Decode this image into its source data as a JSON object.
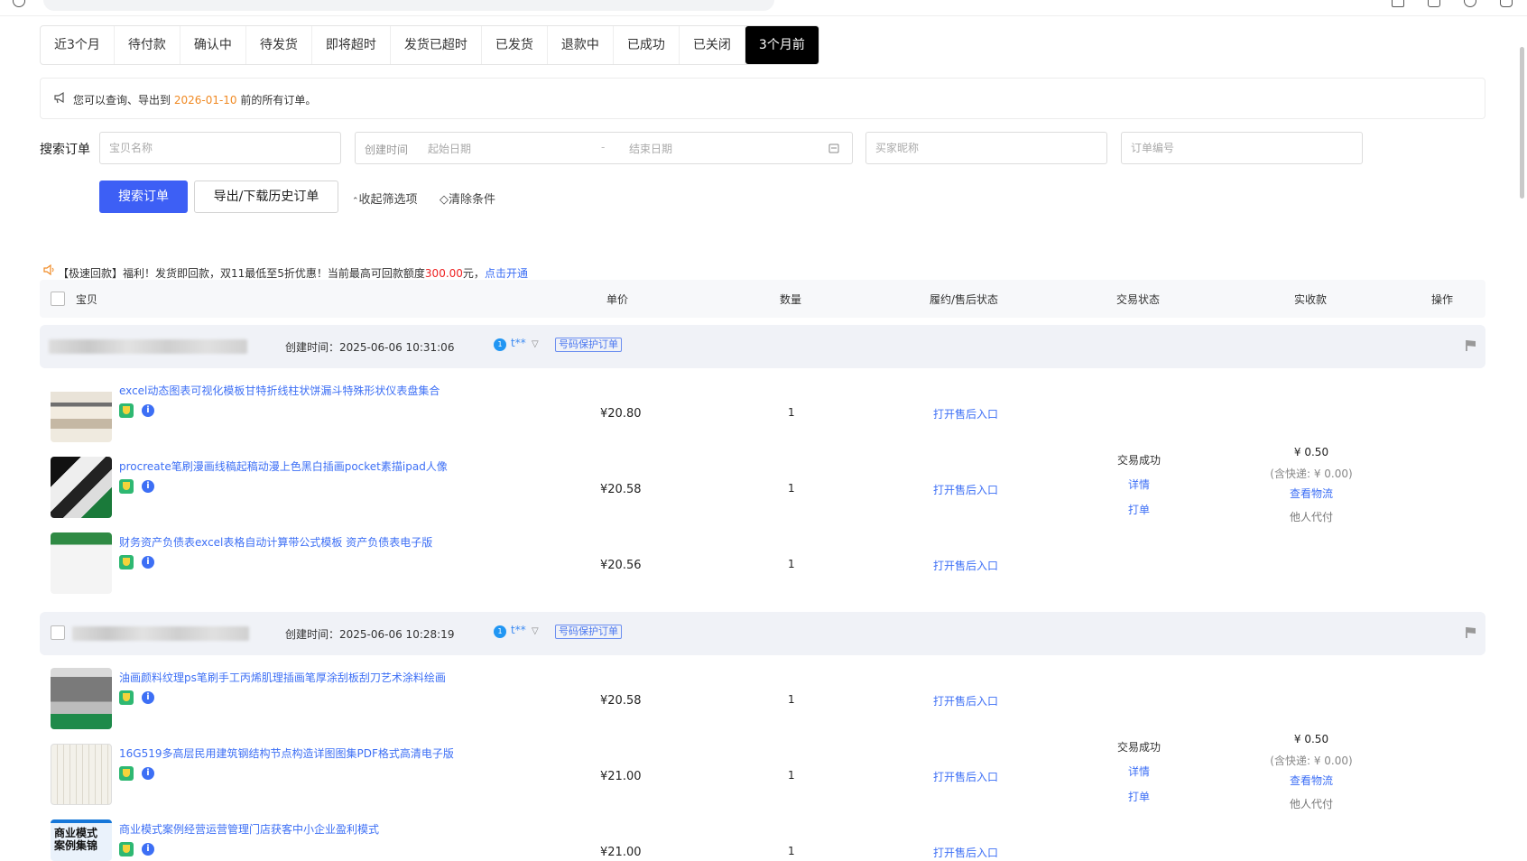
{
  "tabs": [
    "近3个月",
    "待付款",
    "确认中",
    "待发货",
    "即将超时",
    "发货已超时",
    "已发货",
    "退款中",
    "已成功",
    "已关闭",
    "3个月前"
  ],
  "active_tab": "3个月前",
  "notice": {
    "prefix": "您可以查询、导出到 ",
    "date": "2026-01-10",
    "suffix": " 前的所有订单。"
  },
  "search": {
    "label": "搜索订单",
    "item_name_placeholder": "宝贝名称",
    "created_time_label": "创建时间",
    "start_placeholder": "起始日期",
    "end_placeholder": "结束日期",
    "date_sep": "-",
    "buyer_placeholder": "买家昵称",
    "order_no_placeholder": "订单编号",
    "search_button": "搜索订单",
    "export_button": "导出/下载历史订单",
    "collapse_link": "收起筛选项",
    "clear_link": "清除条件"
  },
  "promo": {
    "prefix": "【极速回款】福利！发货即回款，双11最低至5折优惠！当前最高可回款额度",
    "amount": "300.00",
    "unit": "元，",
    "link": "点击开通"
  },
  "table_headers": {
    "item": "宝贝",
    "unit_price": "单价",
    "quantity": "数量",
    "after_sale": "履约/售后状态",
    "trade_status": "交易状态",
    "received": "实收款",
    "action": "操作"
  },
  "orders": [
    {
      "created": "创建时间：2025-06-06 10:31:06",
      "buyer": "t**",
      "protect_tag": "号码保护订单",
      "trade_status": "交易成功",
      "detail_link": "详情",
      "print_link": "打单",
      "received": "¥ 0.50",
      "shipping_note": "(含快递: ¥ 0.00)",
      "logistics_link": "查看物流",
      "paid_by": "他人代付",
      "items": [
        {
          "title": "excel动态图表可视化模板甘特折线柱状饼漏斗特殊形状仪表盘集合",
          "price": "¥20.80",
          "qty": "1",
          "after_sale": "打开售后入口"
        },
        {
          "title": "procreate笔刷漫画线稿起稿动漫上色黑白插画pocket素描ipad人像",
          "price": "¥20.58",
          "qty": "1",
          "after_sale": "打开售后入口"
        },
        {
          "title": "财务资产负债表excel表格自动计算带公式模板 资产负债表电子版",
          "price": "¥20.56",
          "qty": "1",
          "after_sale": "打开售后入口"
        }
      ]
    },
    {
      "created": "创建时间：2025-06-06 10:28:19",
      "buyer": "t**",
      "protect_tag": "号码保护订单",
      "trade_status": "交易成功",
      "detail_link": "详情",
      "print_link": "打单",
      "received": "¥ 0.50",
      "shipping_note": "(含快递: ¥ 0.00)",
      "logistics_link": "查看物流",
      "paid_by": "他人代付",
      "items": [
        {
          "title": "油画颜料纹理ps笔刷手工丙烯肌理插画笔厚涂刮板刮刀艺术涂料绘画",
          "price": "¥20.58",
          "qty": "1",
          "after_sale": "打开售后入口"
        },
        {
          "title": "16G519多高层民用建筑钢结构节点构造详图图集PDF格式高清电子版",
          "price": "¥21.00",
          "qty": "1",
          "after_sale": "打开售后入口"
        },
        {
          "title": "商业模式案例经营运营管理门店获客中小企业盈利模式",
          "price": "¥21.00",
          "qty": "1",
          "after_sale": "打开售后入口",
          "thumb_text": "商业模式 案例集锦"
        }
      ]
    }
  ],
  "colors": {
    "accent": "#3d5ff5",
    "link": "#3d6ff5",
    "date_highlight": "#f08a24",
    "promo_amount": "#e22222"
  }
}
